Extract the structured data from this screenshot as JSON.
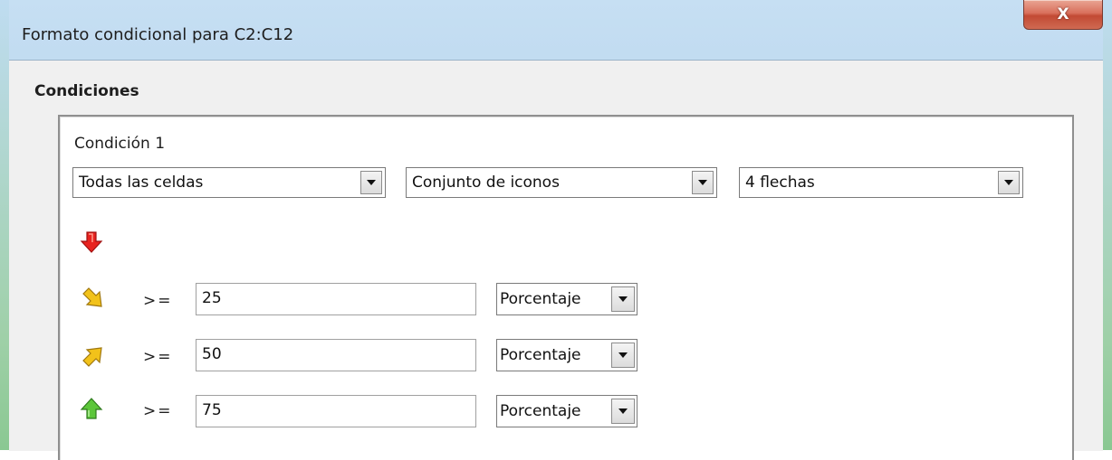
{
  "window": {
    "title": "Formato condicional para C2:C12",
    "close_label": "X"
  },
  "conditions": {
    "section_label": "Condiciones",
    "items": [
      {
        "title": "Condición 1",
        "applies_to": "Todas las celdas",
        "type": "Conjunto de iconos",
        "icon_set": "4 flechas",
        "thresholds": [
          {
            "icon": "red-down-arrow-icon",
            "operator": null,
            "value": null,
            "unit": null
          },
          {
            "icon": "yellow-diagonal-down-arrow-icon",
            "operator": ">=",
            "value": "25",
            "unit": "Porcentaje"
          },
          {
            "icon": "yellow-diagonal-up-arrow-icon",
            "operator": ">=",
            "value": "50",
            "unit": "Porcentaje"
          },
          {
            "icon": "green-up-arrow-icon",
            "operator": ">=",
            "value": "75",
            "unit": "Porcentaje"
          }
        ]
      }
    ]
  },
  "colors": {
    "red_arrow": "#e8231f",
    "yellow_arrow": "#f2c21a",
    "green_arrow": "#5cc63a",
    "close_button": "#c9553f"
  }
}
